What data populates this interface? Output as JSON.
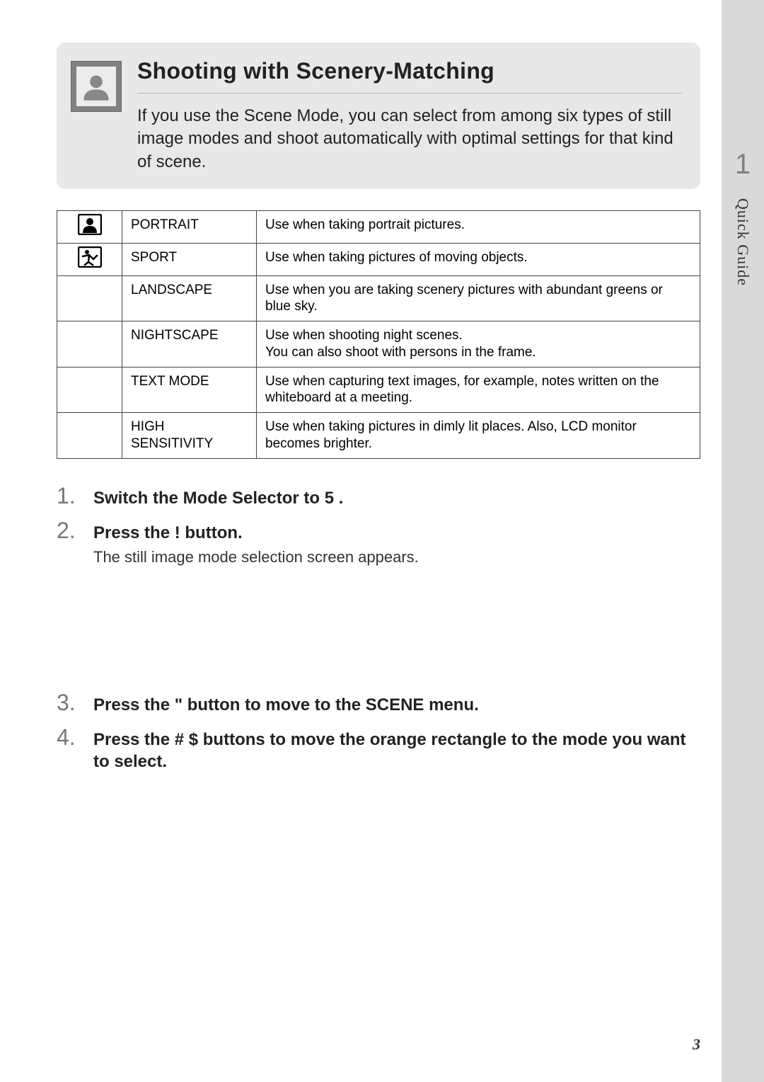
{
  "header": {
    "title": "Shooting with Scenery-Matching",
    "intro": "If you use the Scene Mode, you can select from among six types of still image modes and shoot automatically with optimal settings for that kind of scene."
  },
  "sidebar": {
    "chapter_number": "1",
    "chapter_label": "Quick Guide"
  },
  "table": {
    "rows": [
      {
        "icon": "portrait",
        "mode": "PORTRAIT",
        "desc": "Use when taking portrait pictures."
      },
      {
        "icon": "sport",
        "mode": "SPORT",
        "desc": "Use when taking pictures of moving objects."
      },
      {
        "icon": "",
        "mode": "LANDSCAPE",
        "desc": "Use when you are taking scenery pictures with abundant greens or blue sky."
      },
      {
        "icon": "",
        "mode": "NIGHTSCAPE",
        "desc": "Use when shooting night scenes.\nYou can also shoot with persons in the frame."
      },
      {
        "icon": "",
        "mode": "TEXT MODE",
        "desc": "Use when capturing text images, for example, notes written on the whiteboard at a meeting."
      },
      {
        "icon": "",
        "mode": "HIGH SENSITIVITY",
        "desc": "Use when taking pictures in dimly lit places. Also, LCD monitor becomes brighter."
      }
    ]
  },
  "steps": [
    {
      "head": "Switch the Mode Selector to 5 .",
      "body": ""
    },
    {
      "head": "Press the !   button.",
      "body": "The still image mode selection screen appears."
    },
    {
      "head": "Press the \"   button to move to the SCENE menu.",
      "body": ""
    },
    {
      "head": "Press the # $  buttons to move the orange rectangle to the mode you want to select.",
      "body": ""
    }
  ],
  "page_number": "3"
}
